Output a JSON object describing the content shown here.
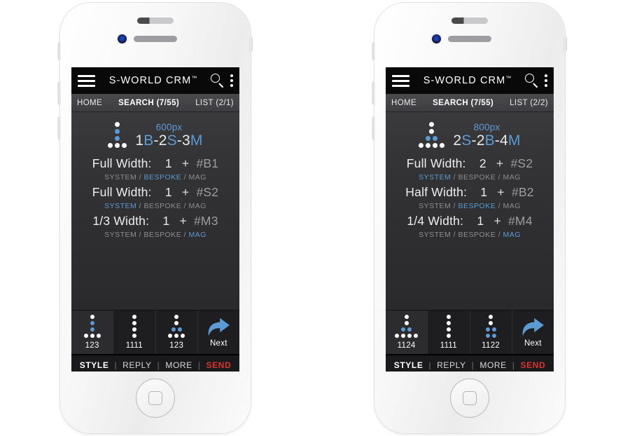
{
  "phones": [
    {
      "id": "phone-left",
      "topbar": {
        "title": "S-WORLD CRM",
        "trademark": "™",
        "menu_icon": "hamburger-icon",
        "search_icon": "search-icon",
        "more_icon": "kebab-menu-icon"
      },
      "navbar": {
        "home": "HOME",
        "search": "SEARCH (7/55)",
        "list": "LIST (2/1)"
      },
      "summary": {
        "px": "600px",
        "code_parts": [
          {
            "t": "1",
            "blue": false
          },
          {
            "t": "B",
            "blue": true
          },
          {
            "t": "-2",
            "blue": false
          },
          {
            "t": "S",
            "blue": true
          },
          {
            "t": "-3",
            "blue": false
          },
          {
            "t": "M",
            "blue": true
          }
        ],
        "glyph": {
          "rows": [
            [
              {
                "c": "w"
              }
            ],
            [
              {
                "c": "b"
              }
            ],
            [
              {
                "c": "b"
              }
            ],
            [
              {
                "c": "w"
              },
              {
                "c": "w"
              },
              {
                "c": "w"
              }
            ]
          ]
        }
      },
      "rows": [
        {
          "label": "Full Width:",
          "value": "1",
          "plus": "+",
          "tag": "#B1",
          "options": [
            "SYSTEM",
            "BESPOKE",
            "MAG"
          ],
          "selected": "BESPOKE"
        },
        {
          "label": "Full Width:",
          "value": "1",
          "plus": "+",
          "tag": "#S2",
          "options": [
            "SYSTEM",
            "BESPOKE",
            "MAG"
          ],
          "selected": "SYSTEM"
        },
        {
          "label": "1/3 Width:",
          "value": "1",
          "plus": "+",
          "tag": "#M3",
          "options": [
            "SYSTEM",
            "BESPOKE",
            "MAG"
          ],
          "selected": "MAG"
        }
      ],
      "icons": [
        {
          "caption": "123",
          "selected": true,
          "glyph": {
            "rows": [
              [
                {
                  "c": "w"
                }
              ],
              [
                {
                  "c": "b"
                }
              ],
              [
                {
                  "c": "b"
                }
              ],
              [
                {
                  "c": "w"
                },
                {
                  "c": "w"
                },
                {
                  "c": "w"
                }
              ]
            ]
          }
        },
        {
          "caption": "1111",
          "selected": false,
          "glyph": {
            "rows": [
              [
                {
                  "c": "w"
                }
              ],
              [
                {
                  "c": "w"
                }
              ],
              [
                {
                  "c": "w"
                }
              ],
              [
                {
                  "c": "w"
                }
              ]
            ]
          }
        },
        {
          "caption": "123",
          "selected": false,
          "glyph": {
            "rows": [
              [
                {
                  "c": "w"
                }
              ],
              [
                {
                  "c": "w"
                }
              ],
              [
                {
                  "c": "b"
                },
                {
                  "c": "b"
                }
              ],
              [
                {
                  "c": "w"
                },
                {
                  "c": "w"
                },
                {
                  "c": "w"
                }
              ]
            ]
          }
        },
        {
          "caption": "Next",
          "selected": false,
          "glyph": null,
          "icon": "forward-arrow-icon"
        }
      ],
      "actionbar": {
        "style": "STYLE",
        "reply": "REPLY",
        "more": "MORE",
        "send": "SEND",
        "sep": "|"
      }
    },
    {
      "id": "phone-right",
      "topbar": {
        "title": "S-WORLD CRM",
        "trademark": "™",
        "menu_icon": "hamburger-icon",
        "search_icon": "search-icon",
        "more_icon": "kebab-menu-icon"
      },
      "navbar": {
        "home": "HOME",
        "search": "SEARCH (7/55)",
        "list": "LIST (2/2)"
      },
      "summary": {
        "px": "800px",
        "code_parts": [
          {
            "t": "2",
            "blue": false
          },
          {
            "t": "S",
            "blue": true
          },
          {
            "t": "-2",
            "blue": false
          },
          {
            "t": "B",
            "blue": true
          },
          {
            "t": "-4",
            "blue": false
          },
          {
            "t": "M",
            "blue": true
          }
        ],
        "glyph": {
          "rows": [
            [
              {
                "c": "w"
              }
            ],
            [
              {
                "c": "w"
              }
            ],
            [
              {
                "c": "b"
              },
              {
                "c": "b"
              }
            ],
            [
              {
                "c": "w"
              },
              {
                "c": "w"
              },
              {
                "c": "w"
              },
              {
                "c": "w"
              }
            ]
          ]
        }
      },
      "rows": [
        {
          "label": "Full Width:",
          "value": "2",
          "plus": "+",
          "tag": "#S2",
          "options": [
            "SYSTEM",
            "BESPOKE",
            "MAG"
          ],
          "selected": "SYSTEM"
        },
        {
          "label": "Half Width:",
          "value": "1",
          "plus": "+",
          "tag": "#B2",
          "options": [
            "SYSTEM",
            "BESPOKE",
            "MAG"
          ],
          "selected": "BESPOKE"
        },
        {
          "label": "1/4 Width:",
          "value": "1",
          "plus": "+",
          "tag": "#M4",
          "options": [
            "SYSTEM",
            "BESPOKE",
            "MAG"
          ],
          "selected": "MAG"
        }
      ],
      "icons": [
        {
          "caption": "1124",
          "selected": true,
          "glyph": {
            "rows": [
              [
                {
                  "c": "w"
                }
              ],
              [
                {
                  "c": "w"
                }
              ],
              [
                {
                  "c": "b"
                },
                {
                  "c": "b"
                }
              ],
              [
                {
                  "c": "w"
                },
                {
                  "c": "w"
                },
                {
                  "c": "w"
                },
                {
                  "c": "w"
                }
              ]
            ]
          }
        },
        {
          "caption": "1111",
          "selected": false,
          "glyph": {
            "rows": [
              [
                {
                  "c": "w"
                }
              ],
              [
                {
                  "c": "w"
                }
              ],
              [
                {
                  "c": "w"
                }
              ],
              [
                {
                  "c": "w"
                }
              ]
            ]
          }
        },
        {
          "caption": "1122",
          "selected": false,
          "glyph": {
            "rows": [
              [
                {
                  "c": "w"
                }
              ],
              [
                {
                  "c": "w"
                }
              ],
              [
                {
                  "c": "b"
                },
                {
                  "c": "b"
                }
              ],
              [
                {
                  "c": "b"
                },
                {
                  "c": "b"
                }
              ]
            ]
          }
        },
        {
          "caption": "Next",
          "selected": false,
          "glyph": null,
          "icon": "forward-arrow-icon"
        }
      ],
      "actionbar": {
        "style": "STYLE",
        "reply": "REPLY",
        "more": "MORE",
        "send": "SEND",
        "sep": "|"
      }
    }
  ],
  "colors": {
    "accent_blue": "#5a9bd5",
    "send_red": "#d9352c",
    "screen_black": "#09090a",
    "screen_dark": "#2b2b2d"
  }
}
